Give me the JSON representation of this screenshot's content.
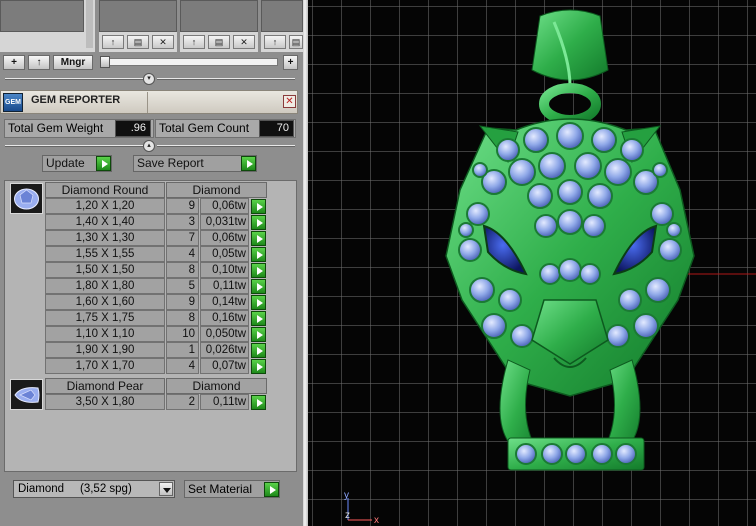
{
  "toolbar": {
    "add_label": "+",
    "up_label": "↑",
    "mngr_label": "Mngr",
    "plus_label": "+",
    "slot_buttons": [
      "↑",
      "▤",
      "✕"
    ]
  },
  "panel": {
    "title": "GEM REPORTER",
    "icon_text": "GEM",
    "close_label": "✕"
  },
  "totals": {
    "weight_label": "Total Gem Weight",
    "weight_value": ".96",
    "count_label": "Total Gem Count",
    "count_value": "70"
  },
  "actions": {
    "update_label": "Update",
    "save_label": "Save Report"
  },
  "gem_groups": [
    {
      "shape": "Diamond Round",
      "material": "Diamond",
      "rows": [
        {
          "size": "1,20 X 1,20",
          "count": "9",
          "weight": "0,06tw"
        },
        {
          "size": "1,40 X 1,40",
          "count": "3",
          "weight": "0,031tw"
        },
        {
          "size": "1,30 X 1,30",
          "count": "7",
          "weight": "0,06tw"
        },
        {
          "size": "1,55 X 1,55",
          "count": "4",
          "weight": "0,05tw"
        },
        {
          "size": "1,50 X 1,50",
          "count": "8",
          "weight": "0,10tw"
        },
        {
          "size": "1,80 X 1,80",
          "count": "5",
          "weight": "0,11tw"
        },
        {
          "size": "1,60 X 1,60",
          "count": "9",
          "weight": "0,14tw"
        },
        {
          "size": "1,75 X 1,75",
          "count": "8",
          "weight": "0,16tw"
        },
        {
          "size": "1,10 X 1,10",
          "count": "10",
          "weight": "0,050tw"
        },
        {
          "size": "1,90 X 1,90",
          "count": "1",
          "weight": "0,026tw"
        },
        {
          "size": "1,70 X 1,70",
          "count": "4",
          "weight": "0,07tw"
        }
      ]
    },
    {
      "shape": "Diamond Pear",
      "material": "Diamond",
      "rows": [
        {
          "size": "3,50 X 1,80",
          "count": "2",
          "weight": "0,11tw"
        }
      ]
    }
  ],
  "material": {
    "selected": "Diamond     (3,52 spg)",
    "set_label": "Set Material"
  },
  "viewport": {
    "axis_y": "y",
    "axis_z": "z",
    "axis_x": "x"
  },
  "colors": {
    "model_green": "#2fae4a",
    "gem_blue": "#8fa8e8",
    "eye_blue": "#1a2a8a",
    "accent_green": "#3cc03c"
  }
}
